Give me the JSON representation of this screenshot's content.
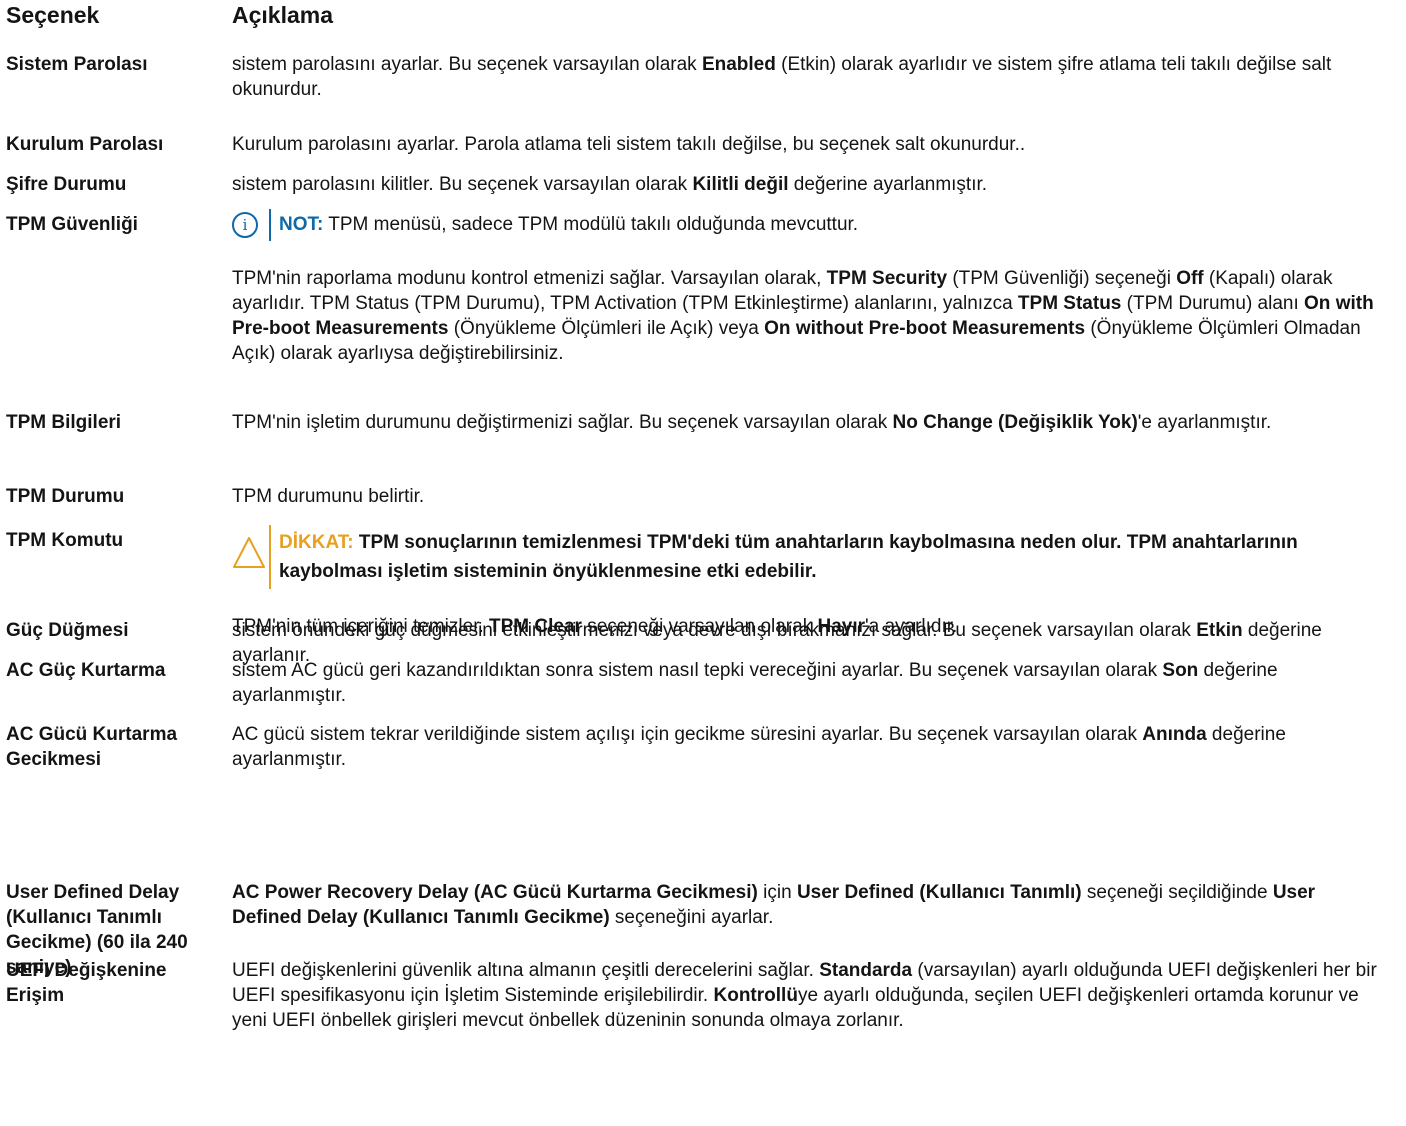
{
  "header": {
    "option": "Seçenek",
    "description": "Açıklama"
  },
  "rows": [
    {
      "label": "Sistem Parolası",
      "desc": [
        "sistem parolasını ayarlar. Bu seçenek varsayılan olarak ",
        {
          "b": "Enabled"
        },
        " (Etkin) olarak ayarlıdır ve sistem şifre atlama teli takılı değilse salt okunurdur."
      ]
    },
    {
      "label": "Kurulum Parolası",
      "desc": [
        "Kurulum parolasını ayarlar. Parola atlama teli sistem takılı değilse, bu seçenek salt okunurdur.."
      ]
    },
    {
      "label": "Şifre Durumu",
      "desc": [
        "sistem parolasını kilitler. Bu seçenek varsayılan olarak ",
        {
          "b": "Kilitli değil"
        },
        " değerine ayarlanmıştır."
      ]
    },
    {
      "label": "TPM Güvenliği",
      "note": {
        "icon": "info-icon",
        "prefix": "NOT:",
        "text": " TPM menüsü, sadece TPM modülü takılı olduğunda mevcuttur."
      },
      "desc": [
        "TPM'nin raporlama modunu kontrol etmenizi sağlar. Varsayılan olarak, ",
        {
          "b": "TPM Security"
        },
        " (TPM Güvenliği) seçeneği ",
        {
          "b": "Off"
        },
        " (Kapalı) olarak ayarlıdır. TPM Status (TPM Durumu), TPM Activation (TPM Etkinleştirme) alanlarını, yalnızca ",
        {
          "b": "TPM Status"
        },
        " (TPM Durumu) alanı ",
        {
          "b": "On with Pre-boot Measurements"
        },
        " (Önyükleme Ölçümleri ile Açık) veya ",
        {
          "b": "On without Pre-boot Measurements"
        },
        " (Önyükleme Ölçümleri Olmadan Açık) olarak ayarlıysa değiştirebilirsiniz."
      ]
    },
    {
      "label": "TPM Bilgileri",
      "desc": [
        "TPM'nin işletim durumunu değiştirmenizi sağlar. Bu seçenek varsayılan olarak ",
        {
          "b": "No Change (Değişiklik Yok)"
        },
        "'e ayarlanmıştır."
      ]
    },
    {
      "label": "TPM Durumu",
      "desc": [
        "TPM durumunu belirtir."
      ]
    },
    {
      "label": "TPM Komutu",
      "caution": {
        "icon": "caution-triangle-icon",
        "prefix": "DİKKAT:",
        "text": " TPM sonuçlarının temizlenmesi TPM'deki tüm anahtarların kaybolmasına neden olur. TPM anahtarlarının kaybolması işletim sisteminin önyüklenmesine etki edebilir."
      },
      "desc": [
        "TPM'nin tüm içeriğini temizler. ",
        {
          "b": "TPM Clear"
        },
        " seçeneği varsayılan olarak ",
        {
          "b": "Hayır"
        },
        "'a ayarlıdır."
      ]
    },
    {
      "label": "Güç Düğmesi",
      "desc": [
        "sistem önündeki güç düğmesini etkinleştirmenizi veya devre dışı bırakmanızı sağlar. Bu seçenek varsayılan olarak ",
        {
          "b": "Etkin"
        },
        " değerine ayarlanır."
      ]
    },
    {
      "label": "AC Güç Kurtarma",
      "desc": [
        "sistem AC gücü geri kazandırıldıktan sonra sistem nasıl tepki vereceğini ayarlar. Bu seçenek varsayılan olarak ",
        {
          "b": "Son"
        },
        " değerine ayarlanmıştır."
      ]
    },
    {
      "label": "AC Gücü Kurtarma Gecikmesi",
      "desc": [
        "AC gücü sistem tekrar verildiğinde sistem açılışı için gecikme süresini ayarlar. Bu seçenek varsayılan olarak ",
        {
          "b": "Anında"
        },
        " değerine ayarlanmıştır."
      ]
    },
    {
      "label": "User Defined Delay (Kullanıcı Tanımlı Gecikme) (60 ila 240 saniye)",
      "desc": [
        {
          "b": "AC Power Recovery Delay (AC Gücü Kurtarma Gecikmesi)"
        },
        " için ",
        {
          "b": "User Defined (Kullanıcı Tanımlı)"
        },
        " seçeneği seçildiğinde ",
        {
          "b": "User Defined Delay (Kullanıcı Tanımlı Gecikme)"
        },
        " seçeneğini ayarlar."
      ]
    },
    {
      "label": "UEFI Değişkenine Erişim",
      "desc": [
        "UEFI değişkenlerini güvenlik altına almanın çeşitli derecelerini sağlar. ",
        {
          "b": "Standarda"
        },
        " (varsayılan) ayarlı olduğunda UEFI değişkenleri her bir UEFI spesifikasyonu için İşletim Sisteminde erişilebilirdir. ",
        {
          "b": "Kontrollü"
        },
        "ye ayarlı olduğunda, seçilen UEFI değişkenleri ortamda korunur ve yeni UEFI önbellek girişleri mevcut önbellek düzeninin sonunda olmaya zorlanır."
      ]
    }
  ]
}
